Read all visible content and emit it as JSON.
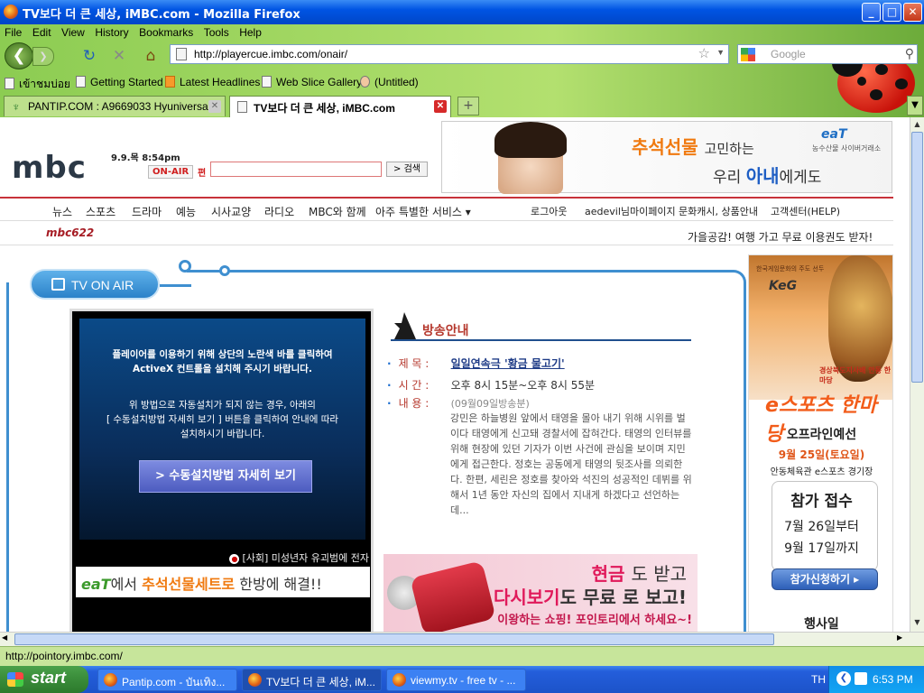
{
  "window": {
    "title": "TV보다 더 큰 세상, iMBC.com - Mozilla Firefox",
    "minimize": "_",
    "maximize": "□",
    "close": "✕"
  },
  "menu": [
    "File",
    "Edit",
    "View",
    "History",
    "Bookmarks",
    "Tools",
    "Help"
  ],
  "nav": {
    "back_icon": "back-arrow-icon",
    "url": "http://playercue.imbc.com/onair/",
    "search_placeholder": "Google"
  },
  "bookmarks": [
    "เข้าชมบ่อย",
    "Getting Started",
    "Latest Headlines",
    "Web Slice Gallery",
    "(Untitled)"
  ],
  "tabs": [
    {
      "label": "PANTIP.COM : A9669033 Hyuniversal...",
      "active": false
    },
    {
      "label": "TV보다 더 큰 세상, iMBC.com",
      "active": true
    }
  ],
  "page": {
    "logo": "mbc",
    "datetime": "9.9.목 8:54pm",
    "onair_label": "ON-AIR",
    "search_select": "편",
    "search_button": "> 검색",
    "top_ad": {
      "headline": "추석선물",
      "headline_rest": "고민하는",
      "line2_a": "우리",
      "line2_b": "아내",
      "line2_c": "에게도",
      "brand": "eaT",
      "brand_sub": "농수산물 사이버거래소"
    },
    "gnb": [
      "뉴스",
      "스포츠",
      "드라마",
      "예능",
      "시사교양",
      "라디오",
      "MBC와 함께",
      "아주 특별한 서비스 ▾"
    ],
    "util": [
      "로그아웃",
      "aedevil님마이페이지",
      "문화캐시, 상품안내",
      "고객센터(HELP)"
    ],
    "sub_logo": "mbc622",
    "ticker": "가을공감! 여행 가고 무료 이용권도 받자!",
    "tv_on_air": "TV ON AIR",
    "player": {
      "msg1_l1": "플레이어를 이용하기 위해  상단의 노란색 바를 클릭하여",
      "msg1_l2": "ActiveX 컨트롤을 설치해 주시기 바랍니다.",
      "msg2_l1": "위 방법으로 자동설치가 되지 않는 경우, 아래의",
      "msg2_l2": "[ 수동설치방법 자세히 보기 ] 버튼을 클릭하여 안내에 따라",
      "msg2_l3": "설치하시기 바랍니다.",
      "install_button": "> 수동설치방법 자세히 보기",
      "news": "[사회] 미성년자 유괴범에 전자",
      "ad_a": "eaT",
      "ad_b": "에서",
      "ad_c": "추석선물세트로",
      "ad_d": "한방에 해결!!"
    },
    "broadcast": {
      "heading": "방송안내",
      "title_label": "제    목 :",
      "title_value": "일일연속극 '황금 물고기'",
      "time_label": "시    간 :",
      "time_value": "오후 8시 15분~오후 8시 55분",
      "content_label": "내    용 :",
      "content_date": "(09월09일방송분)",
      "synopsis": "강민은 하늘병원 앞에서 태영을 몰아 내기 위해 시위를 벌이다 태영에게 신고돼 경찰서에 잡혀간다. 태영의 인터뷰를 위해 현장에 있던 기자가 이번 사건에 관심을 보이며 지민에게 접근한다. 정호는 공동에게 태영의 뒷조사를 의뢰한다. 한편, 세린은 정호를 찾아와 석진의 성공적인 데뷔를 위해서 1년 동안 자신의 집에서 지내게 하겠다고 선언하는데..."
    },
    "promo": {
      "l1a": "현금",
      "l1b": "도 받고",
      "l2a": "다시보기",
      "l2b": "도 무료",
      "l2c": "로 보고!",
      "l3": "이왕하는 쇼핑! 포인토리에서 하세요~!"
    },
    "side_ad": {
      "org_sub": "한국게임문화의 주도 선두",
      "org": "KeG",
      "region": "경상북도지사배 안동 한마당",
      "sports": "e스포츠 한마당",
      "offline": "오프라인예선",
      "date": "9월 25일(토요일)",
      "place": "안동체육관 e스포츠 경기장",
      "reg_title": "참가 접수",
      "reg_d1": "7월 26일부터",
      "reg_d2": "9월 17일까지",
      "apply_button": "참가신청하기 ▸",
      "event": "행사일"
    }
  },
  "status_text": "http://pointory.imbc.com/",
  "taskbar": {
    "start": "start",
    "tasks": [
      {
        "label": "Pantip.com - บันเทิง...",
        "active": false
      },
      {
        "label": "TV보다 더 큰 세상, iM...",
        "active": true
      },
      {
        "label": "viewmy.tv - free tv - ...",
        "active": false
      }
    ],
    "lang": "TH",
    "clock": "6:53 PM"
  },
  "colors": {
    "chrome_green": "#8ccc52",
    "xp_blue": "#0054e3",
    "mbc_red": "#c8323a",
    "tv_blue": "#3f8fd0"
  }
}
